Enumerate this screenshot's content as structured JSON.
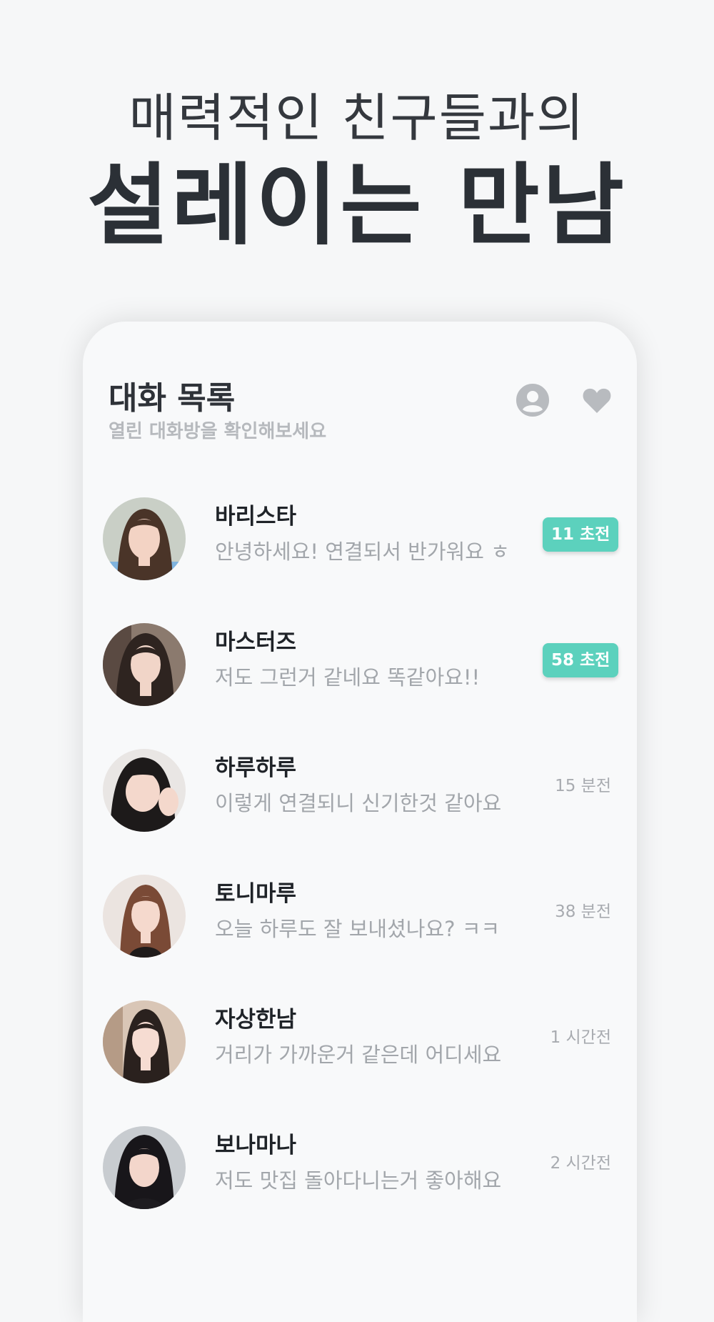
{
  "hero": {
    "line1": "매력적인 친구들과의",
    "line2": "설레이는 만남"
  },
  "header": {
    "title": "대화 목록",
    "subtitle": "열린 대화방을 확인해보세요",
    "icons": [
      "profile-icon",
      "heart-icon"
    ]
  },
  "colors": {
    "accent": "#5cd1bd",
    "title_text": "#2e3238",
    "muted_text": "#a2a6ab",
    "icon_gray": "#b8bbbf"
  },
  "chats": [
    {
      "name": "바리스타",
      "preview": "안녕하세요! 연결되서 반가워요 ㅎ",
      "badge": "11 초전",
      "time": ""
    },
    {
      "name": "마스터즈",
      "preview": "저도 그런거 같네요 똑같아요!!",
      "badge": "58 초전",
      "time": ""
    },
    {
      "name": "하루하루",
      "preview": "이렇게 연결되니 신기한것 같아요",
      "badge": "",
      "time": "15 분전"
    },
    {
      "name": "토니마루",
      "preview": "오늘 하루도 잘 보내셨나요? ㅋㅋ",
      "badge": "",
      "time": "38 분전"
    },
    {
      "name": "자상한남",
      "preview": "거리가 가까운거 같은데 어디세요",
      "badge": "",
      "time": "1 시간전"
    },
    {
      "name": "보나마나",
      "preview": "저도 맛집 돌아다니는거 좋아해요",
      "badge": "",
      "time": "2 시간전"
    }
  ]
}
